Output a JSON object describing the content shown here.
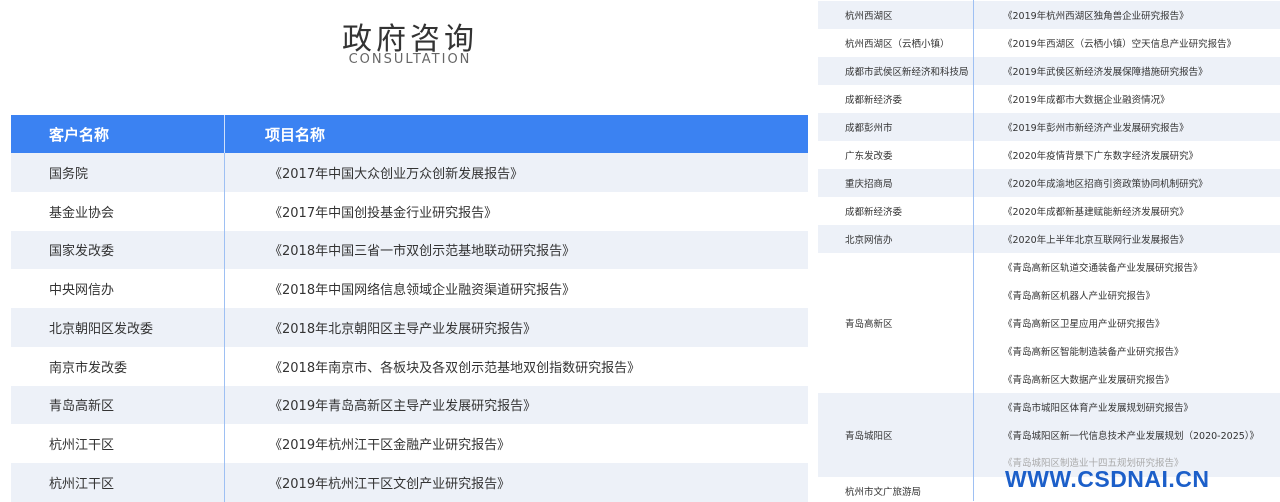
{
  "header": {
    "title": "政府咨询",
    "subtitle": "CONSULTATION"
  },
  "left_table": {
    "columns": [
      "客户名称",
      "项目名称"
    ],
    "rows": [
      [
        "国务院",
        "《2017年中国大众创业万众创新发展报告》"
      ],
      [
        "基金业协会",
        "《2017年中国创投基金行业研究报告》"
      ],
      [
        "国家发改委",
        "《2018年中国三省一市双创示范基地联动研究报告》"
      ],
      [
        "中央网信办",
        "《2018年中国网络信息领域企业融资渠道研究报告》"
      ],
      [
        "北京朝阳区发改委",
        "《2018年北京朝阳区主导产业发展研究报告》"
      ],
      [
        "南京市发改委",
        "《2018年南京市、各板块及各双创示范基地双创指数研究报告》"
      ],
      [
        "青岛高新区",
        "《2019年青岛高新区主导产业发展研究报告》"
      ],
      [
        "杭州江干区",
        "《2019年杭州江干区金融产业研究报告》"
      ],
      [
        "杭州江干区",
        "《2019年杭州江干区文创产业研究报告》"
      ]
    ]
  },
  "right_table": {
    "rows": [
      [
        "杭州西湖区",
        "《2019年杭州西湖区独角兽企业研究报告》"
      ],
      [
        "杭州西湖区（云栖小镇）",
        "《2019年西湖区（云栖小镇）空天信息产业研究报告》"
      ],
      [
        "成都市武侯区新经济和科技局",
        "《2019年武侯区新经济发展保障措施研究报告》"
      ],
      [
        "成都新经济委",
        "《2019年成都市大数据企业融资情况》"
      ],
      [
        "成都彭州市",
        "《2019年彭州市新经济产业发展研究报告》"
      ],
      [
        "广东发改委",
        "《2020年疫情背景下广东数字经济发展研究》"
      ],
      [
        "重庆招商局",
        "《2020年成渝地区招商引资政策协同机制研究》"
      ],
      [
        "成都新经济委",
        "《2020年成都新基建赋能新经济发展研究》"
      ],
      [
        "北京网信办",
        "《2020年上半年北京互联网行业发展报告》"
      ]
    ],
    "group_qingdao_gaoxin": {
      "client": "青岛高新区",
      "projects": [
        "《青岛高新区轨道交通装备产业发展研究报告》",
        "《青岛高新区机器人产业研究报告》",
        "《青岛高新区卫星应用产业研究报告》",
        "《青岛高新区智能制造装备产业研究报告》",
        "《青岛高新区大数据产业发展研究报告》"
      ]
    },
    "group_qingdao_chengyang": {
      "client": "青岛城阳区",
      "projects": [
        "《青岛市城阳区体育产业发展规划研究报告》",
        "《青岛城阳区新一代信息技术产业发展规划（2020-2025）》",
        "《青岛城阳区制造业十四五规划研究报告》"
      ]
    },
    "last_row": {
      "client": "杭州市文广旅游局"
    }
  },
  "watermark": "WWW.CSDNAI.CN"
}
